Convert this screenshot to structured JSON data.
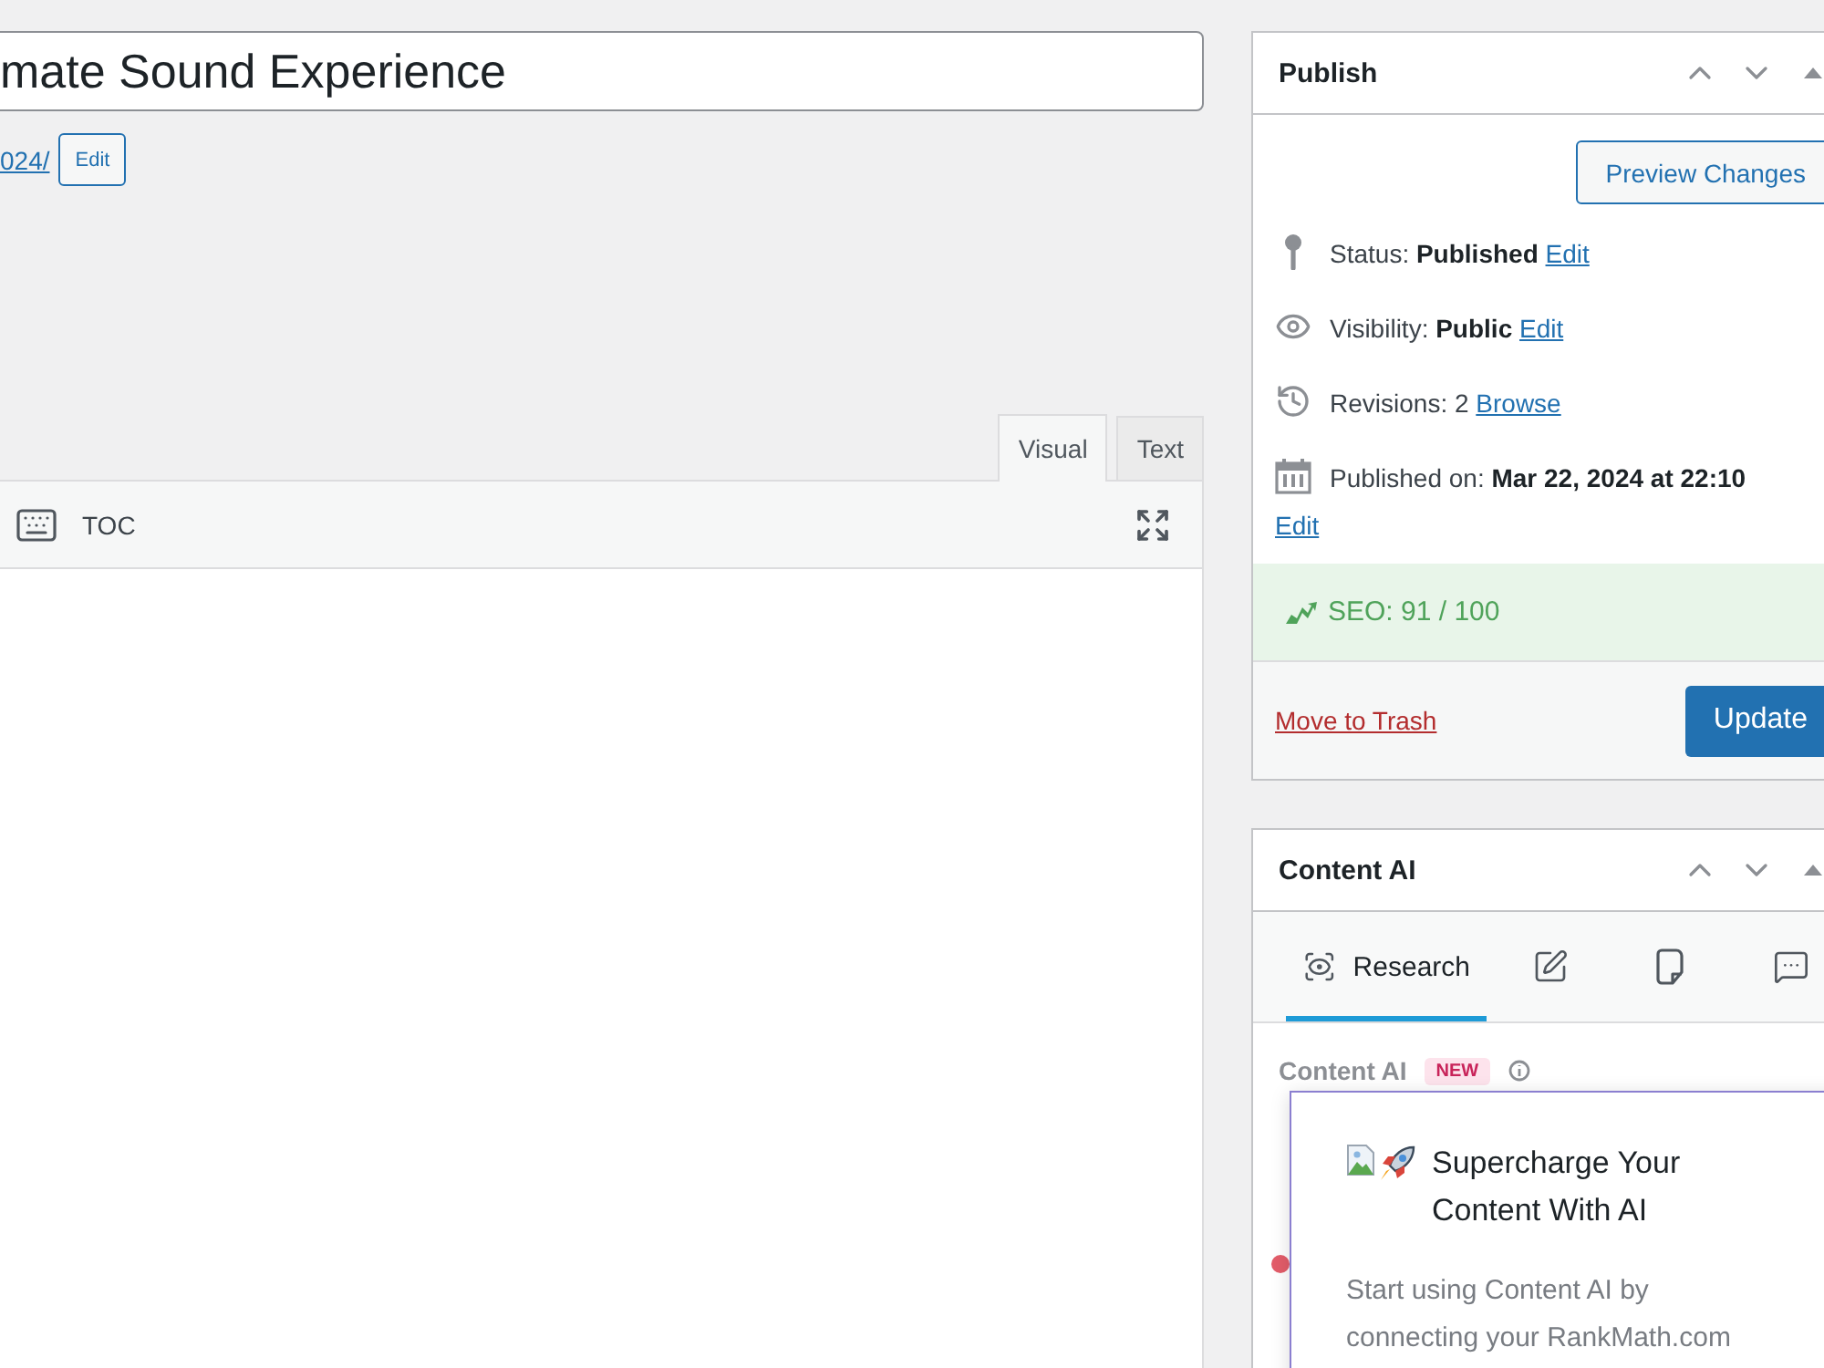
{
  "editor": {
    "title_value": "mate Sound Experience",
    "permalink": {
      "link": "024/",
      "edit_button": "Edit"
    },
    "tabs": [
      {
        "label": "Visual",
        "selected": true
      },
      {
        "label": "Text",
        "selected": false
      }
    ],
    "toolbar": {
      "label": "TOC"
    }
  },
  "publish": {
    "title": "Publish",
    "preview_button": "Preview Changes",
    "rows": [
      {
        "text": "Status: **Published**",
        "link": "Edit"
      },
      {
        "text": "Visibility: **Public**",
        "link": "Edit"
      },
      {
        "text": "Revisions: 2",
        "link": "Browse"
      },
      {
        "text": "Published on: **Mar 22, 2024 at 22:10**",
        "link": "Edit"
      }
    ],
    "seo": "SEO: 91 / 100",
    "trash_link": "Move to Trash",
    "update_button": "Update"
  },
  "content_ai": {
    "title": "Content AI",
    "tabs": [
      {
        "label": "Research",
        "selected": true
      },
      {
        "selected": false
      },
      {
        "selected": false
      },
      {
        "selected": false
      }
    ],
    "blurred_heading": {
      "text": "Content AI",
      "badge": "NEW"
    },
    "popup": {
      "title": "Supercharge Your Content With AI",
      "body": "Start using Content AI by connecting your RankMath.com"
    }
  }
}
